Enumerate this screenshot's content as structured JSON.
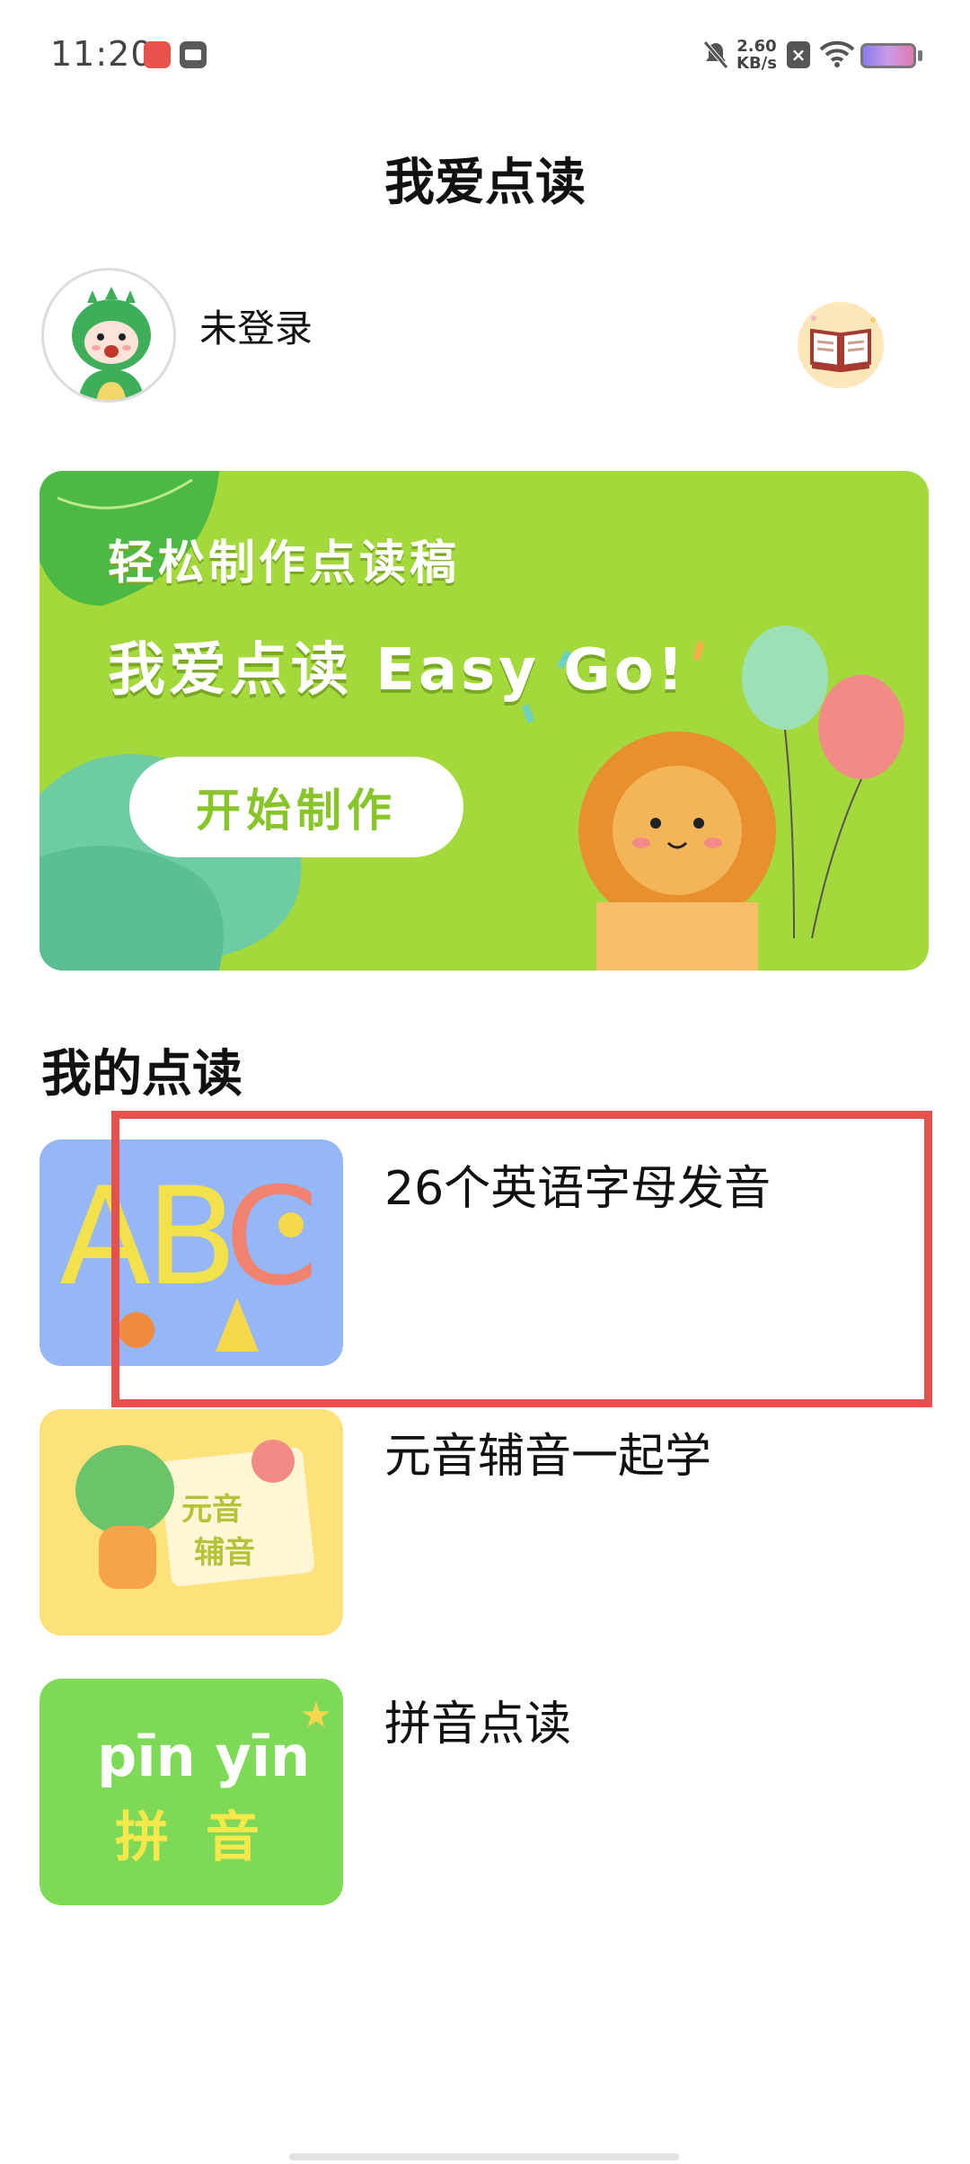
{
  "status_bar": {
    "time": "11:20",
    "net_speed_value": "2.60",
    "net_speed_unit": "KB/s",
    "icons": [
      "huawei-app-icon",
      "calendar-app-icon",
      "mute-bell-icon",
      "close-box-icon",
      "wifi-icon",
      "battery-icon"
    ]
  },
  "header": {
    "title": "我爱点读"
  },
  "profile": {
    "status": "未登录",
    "book_icon": "open-book-icon"
  },
  "banner": {
    "subtitle": "轻松制作点读稿",
    "headline": "我爱点读 Easy Go!",
    "button_label": "开始制作",
    "colors": {
      "background": "#a3d93a",
      "button_text": "#87c528"
    }
  },
  "section": {
    "title": "我的点读"
  },
  "items": [
    {
      "label": "26个英语字母发音",
      "thumb_color": "#95b6f7",
      "thumb_text": "ABC"
    },
    {
      "label": "元音辅音一起学",
      "thumb_color": "#fde27c",
      "thumb_text_1": "元音",
      "thumb_text_2": "辅音"
    },
    {
      "label": "拼音点读",
      "thumb_color": "#7ed957",
      "thumb_text_1": "pīn yīn",
      "thumb_text_2": "拼 音"
    }
  ],
  "highlight_color": "#e5514c"
}
